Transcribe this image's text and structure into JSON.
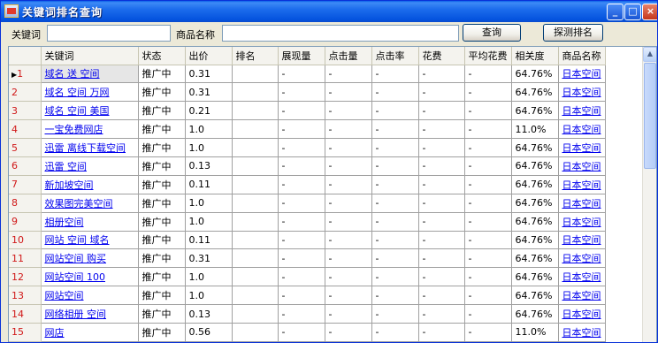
{
  "window": {
    "title": "关键词排名查询"
  },
  "search": {
    "keyword_label": "关键词",
    "keyword_value": "",
    "product_label": "商品名称",
    "product_value": "",
    "query_button": "查询",
    "detect_button": "探测排名"
  },
  "table": {
    "columns": [
      "关键词",
      "状态",
      "出价",
      "排名",
      "展现量",
      "点击量",
      "点击率",
      "花费",
      "平均花费",
      "相关度",
      "商品名称"
    ],
    "rows": [
      {
        "num": "1",
        "keyword": "域名 送 空间",
        "status": "推广中",
        "bid": "0.31",
        "rank": "",
        "impressions": "-",
        "clicks": "-",
        "ctr": "-",
        "cost": "-",
        "avg_cost": "-",
        "relevance": "64.76%",
        "product": "日本空间"
      },
      {
        "num": "2",
        "keyword": "域名 空间 万网",
        "status": "推广中",
        "bid": "0.31",
        "rank": "",
        "impressions": "-",
        "clicks": "-",
        "ctr": "-",
        "cost": "-",
        "avg_cost": "-",
        "relevance": "64.76%",
        "product": "日本空间"
      },
      {
        "num": "3",
        "keyword": "域名 空间 美国",
        "status": "推广中",
        "bid": "0.21",
        "rank": "",
        "impressions": "-",
        "clicks": "-",
        "ctr": "-",
        "cost": "-",
        "avg_cost": "-",
        "relevance": "64.76%",
        "product": "日本空间"
      },
      {
        "num": "4",
        "keyword": "一宝免费网店",
        "status": "推广中",
        "bid": "1.0",
        "rank": "",
        "impressions": "-",
        "clicks": "-",
        "ctr": "-",
        "cost": "-",
        "avg_cost": "-",
        "relevance": "11.0%",
        "product": "日本空间"
      },
      {
        "num": "5",
        "keyword": "迅雷 离线下载空间",
        "status": "推广中",
        "bid": "1.0",
        "rank": "",
        "impressions": "-",
        "clicks": "-",
        "ctr": "-",
        "cost": "-",
        "avg_cost": "-",
        "relevance": "64.76%",
        "product": "日本空间"
      },
      {
        "num": "6",
        "keyword": "迅雷 空间",
        "status": "推广中",
        "bid": "0.13",
        "rank": "",
        "impressions": "-",
        "clicks": "-",
        "ctr": "-",
        "cost": "-",
        "avg_cost": "-",
        "relevance": "64.76%",
        "product": "日本空间"
      },
      {
        "num": "7",
        "keyword": "新加坡空间",
        "status": "推广中",
        "bid": "0.11",
        "rank": "",
        "impressions": "-",
        "clicks": "-",
        "ctr": "-",
        "cost": "-",
        "avg_cost": "-",
        "relevance": "64.76%",
        "product": "日本空间"
      },
      {
        "num": "8",
        "keyword": "效果图完美空间",
        "status": "推广中",
        "bid": "1.0",
        "rank": "",
        "impressions": "-",
        "clicks": "-",
        "ctr": "-",
        "cost": "-",
        "avg_cost": "-",
        "relevance": "64.76%",
        "product": "日本空间"
      },
      {
        "num": "9",
        "keyword": "相册空间",
        "status": "推广中",
        "bid": "1.0",
        "rank": "",
        "impressions": "-",
        "clicks": "-",
        "ctr": "-",
        "cost": "-",
        "avg_cost": "-",
        "relevance": "64.76%",
        "product": "日本空间"
      },
      {
        "num": "10",
        "keyword": "网站 空间 域名",
        "status": "推广中",
        "bid": "0.11",
        "rank": "",
        "impressions": "-",
        "clicks": "-",
        "ctr": "-",
        "cost": "-",
        "avg_cost": "-",
        "relevance": "64.76%",
        "product": "日本空间"
      },
      {
        "num": "11",
        "keyword": "网站空间 购买",
        "status": "推广中",
        "bid": "0.31",
        "rank": "",
        "impressions": "-",
        "clicks": "-",
        "ctr": "-",
        "cost": "-",
        "avg_cost": "-",
        "relevance": "64.76%",
        "product": "日本空间"
      },
      {
        "num": "12",
        "keyword": "网站空间 100",
        "status": "推广中",
        "bid": "1.0",
        "rank": "",
        "impressions": "-",
        "clicks": "-",
        "ctr": "-",
        "cost": "-",
        "avg_cost": "-",
        "relevance": "64.76%",
        "product": "日本空间"
      },
      {
        "num": "13",
        "keyword": "网站空间",
        "status": "推广中",
        "bid": "1.0",
        "rank": "",
        "impressions": "-",
        "clicks": "-",
        "ctr": "-",
        "cost": "-",
        "avg_cost": "-",
        "relevance": "64.76%",
        "product": "日本空间"
      },
      {
        "num": "14",
        "keyword": "网络相册 空间",
        "status": "推广中",
        "bid": "0.13",
        "rank": "",
        "impressions": "-",
        "clicks": "-",
        "ctr": "-",
        "cost": "-",
        "avg_cost": "-",
        "relevance": "64.76%",
        "product": "日本空间"
      },
      {
        "num": "15",
        "keyword": "网店",
        "status": "推广中",
        "bid": "0.56",
        "rank": "",
        "impressions": "-",
        "clicks": "-",
        "ctr": "-",
        "cost": "-",
        "avg_cost": "-",
        "relevance": "11.0%",
        "product": "日本空间"
      }
    ]
  },
  "icons": {
    "row_pointer": "current-row-pointer-icon",
    "scroll_up": "scroll-up-arrow-icon"
  }
}
